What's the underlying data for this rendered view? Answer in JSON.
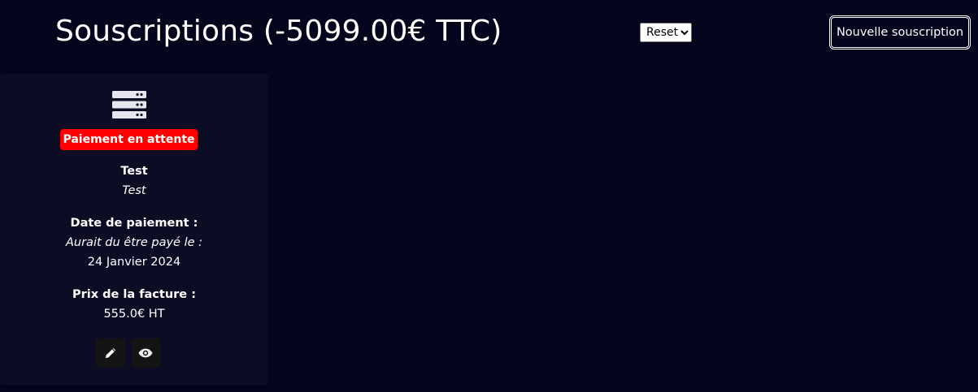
{
  "header": {
    "title": "Souscriptions (-5099.00€ TTC)",
    "filter": {
      "selected": "Reset"
    },
    "new_button_label": "Nouvelle souscription"
  },
  "subscriptions": [
    {
      "icon": "server-icon",
      "status": "Paiement en attente",
      "name": "Test",
      "description": "Test",
      "payment_date_label": "Date de paiement :",
      "payment_note": "Aurait du être payé le :",
      "payment_date": "24 Janvier 2024",
      "price_label": "Prix de la facture :",
      "price": "555.0€ HT",
      "actions": {
        "edit": "pencil-icon",
        "view": "eye-icon"
      }
    }
  ],
  "colors": {
    "background": "#05051e",
    "card": "#0c0d25",
    "status_pending": "#ff0000",
    "action_button": "#141414"
  }
}
